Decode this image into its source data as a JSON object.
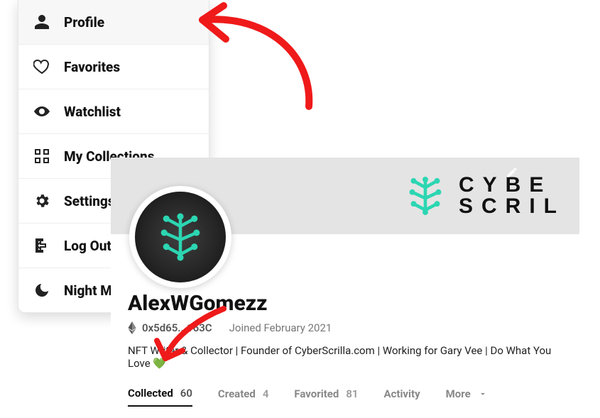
{
  "menu": {
    "items": [
      {
        "label": "Profile"
      },
      {
        "label": "Favorites"
      },
      {
        "label": "Watchlist"
      },
      {
        "label": "My Collections"
      },
      {
        "label": "Settings"
      },
      {
        "label": "Log Out"
      },
      {
        "label": "Night Mode"
      }
    ]
  },
  "profile": {
    "banner": {
      "line1": "CYBE",
      "line2": "SCRIL"
    },
    "username": "AlexWGomezz",
    "wallet": "0x5d65...163C",
    "joined": "Joined February 2021",
    "bio": "NFT Writer & Collector | Founder of CyberScrilla.com | Working for Gary Vee | Do What You Love 💚",
    "tabs": [
      {
        "label": "Collected",
        "count": "60"
      },
      {
        "label": "Created",
        "count": "4"
      },
      {
        "label": "Favorited",
        "count": "81"
      },
      {
        "label": "Activity"
      },
      {
        "label": "More"
      }
    ]
  }
}
